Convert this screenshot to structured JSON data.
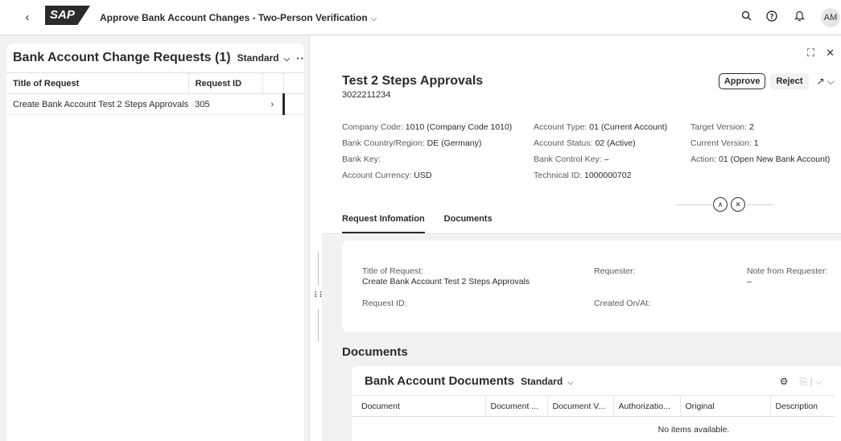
{
  "shell": {
    "app_title": "Approve Bank Account Changes - Two-Person Verification",
    "logo_text": "SAP",
    "user_initials": "AM"
  },
  "master": {
    "title": "Bank Account Change Requests (1)",
    "variant": "Standard",
    "columns": [
      "Title of Request",
      "Request ID"
    ],
    "rows": [
      {
        "title": "Create Bank Account Test 2 Steps Approvals",
        "request_id": "305"
      }
    ]
  },
  "detail": {
    "title": "Test 2 Steps Approvals",
    "subtitle": "3022211234",
    "approve_label": "Approve",
    "reject_label": "Reject",
    "attributes": {
      "col1": [
        {
          "label": "Company Code:",
          "value": "1010 (Company Code 1010)"
        },
        {
          "label": "Bank Country/Region:",
          "value": "DE (Germany)"
        },
        {
          "label": "Bank Key:",
          "value": ""
        },
        {
          "label": "Account Currency:",
          "value": "USD"
        }
      ],
      "col2": [
        {
          "label": "Account Type:",
          "value": "01 (Current Account)"
        },
        {
          "label": "Account Status:",
          "value": "02 (Active)"
        },
        {
          "label": "Bank Control Key:",
          "value": "–"
        },
        {
          "label": "Technical ID:",
          "value": "1000000702"
        }
      ],
      "col3": [
        {
          "label": "Target Version:",
          "value": "2"
        },
        {
          "label": "Current Version:",
          "value": "1"
        },
        {
          "label": "Action:",
          "value": "01 (Open New Bank Account)"
        }
      ]
    },
    "tabs": [
      {
        "label": "Request Infomation",
        "active": true
      },
      {
        "label": "Documents",
        "active": false
      }
    ],
    "request_info": {
      "title_label": "Title of Request:",
      "title_value": "Create Bank Account Test 2 Steps Approvals",
      "request_id_label": "Request ID:",
      "requester_label": "Requester:",
      "created_label": "Created On/At:",
      "note_label": "Note from Requester:",
      "note_value": "–"
    },
    "documents_heading": "Documents",
    "documents": {
      "title": "Bank Account Documents",
      "variant": "Standard",
      "columns": [
        "Document",
        "Document ...",
        "Document V...",
        "Authorizatio...",
        "Original",
        "Description"
      ],
      "empty_text": "No items available."
    }
  }
}
